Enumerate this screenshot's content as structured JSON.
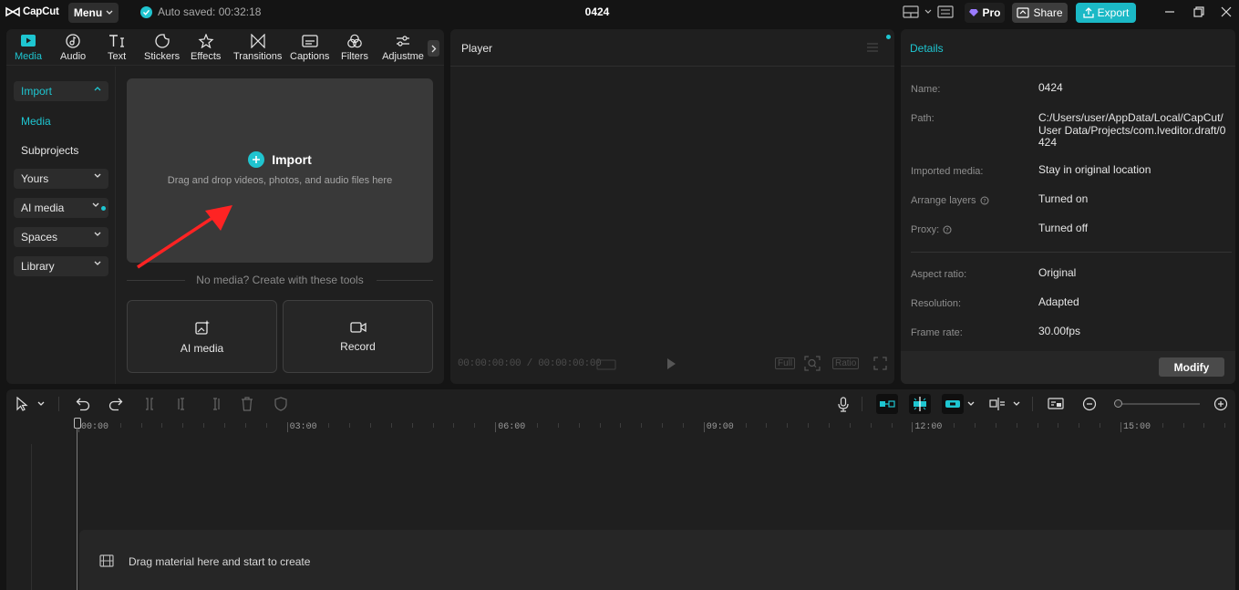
{
  "app": {
    "logo_text": "CapCut",
    "menu_label": "Menu",
    "autosave_text": "Auto saved: 00:32:18",
    "project_title": "0424",
    "pro_label": "Pro",
    "share_label": "Share",
    "export_label": "Export",
    "accent_color": "#1ec6d1"
  },
  "tabs": [
    {
      "label": "Media",
      "icon": "media-icon",
      "active": true
    },
    {
      "label": "Audio",
      "icon": "audio-icon"
    },
    {
      "label": "Text",
      "icon": "text-icon"
    },
    {
      "label": "Stickers",
      "icon": "stickers-icon"
    },
    {
      "label": "Effects",
      "icon": "effects-icon"
    },
    {
      "label": "Transitions",
      "icon": "transitions-icon"
    },
    {
      "label": "Captions",
      "icon": "captions-icon"
    },
    {
      "label": "Filters",
      "icon": "filters-icon"
    },
    {
      "label": "Adjustme",
      "icon": "adjustment-icon"
    }
  ],
  "sidebar": {
    "import": "Import",
    "media": "Media",
    "subprojects": "Subprojects",
    "yours": "Yours",
    "ai_media": "AI media",
    "spaces": "Spaces",
    "library": "Library"
  },
  "media_panel": {
    "import_title": "Import",
    "import_sub": "Drag and drop videos, photos, and audio files here",
    "no_media_text": "No media? Create with these tools",
    "tool_ai_media": "AI media",
    "tool_record": "Record"
  },
  "player": {
    "title": "Player",
    "timecode": "00:00:00:00 / 00:00:00:00",
    "full_label": "Full",
    "ratio_label": "Ratio"
  },
  "details": {
    "title": "Details",
    "rows": [
      {
        "label": "Name:",
        "value": "0424"
      },
      {
        "label": "Path:",
        "value": "C:/Users/user/AppData/Local/CapCut/User Data/Projects/com.lveditor.draft/0424"
      },
      {
        "label": "Imported media:",
        "value": "Stay in original location"
      },
      {
        "label": "Arrange layers",
        "value": "Turned on"
      },
      {
        "label": "Proxy:",
        "value": "Turned off"
      },
      {
        "label": "Aspect ratio:",
        "value": "Original"
      },
      {
        "label": "Resolution:",
        "value": "Adapted"
      },
      {
        "label": "Frame rate:",
        "value": "30.00fps"
      }
    ],
    "modify_label": "Modify"
  },
  "timeline": {
    "ticks": [
      "00:00",
      "03:00",
      "06:00",
      "09:00",
      "12:00",
      "15:00"
    ],
    "drop_text": "Drag material here and start to create"
  }
}
